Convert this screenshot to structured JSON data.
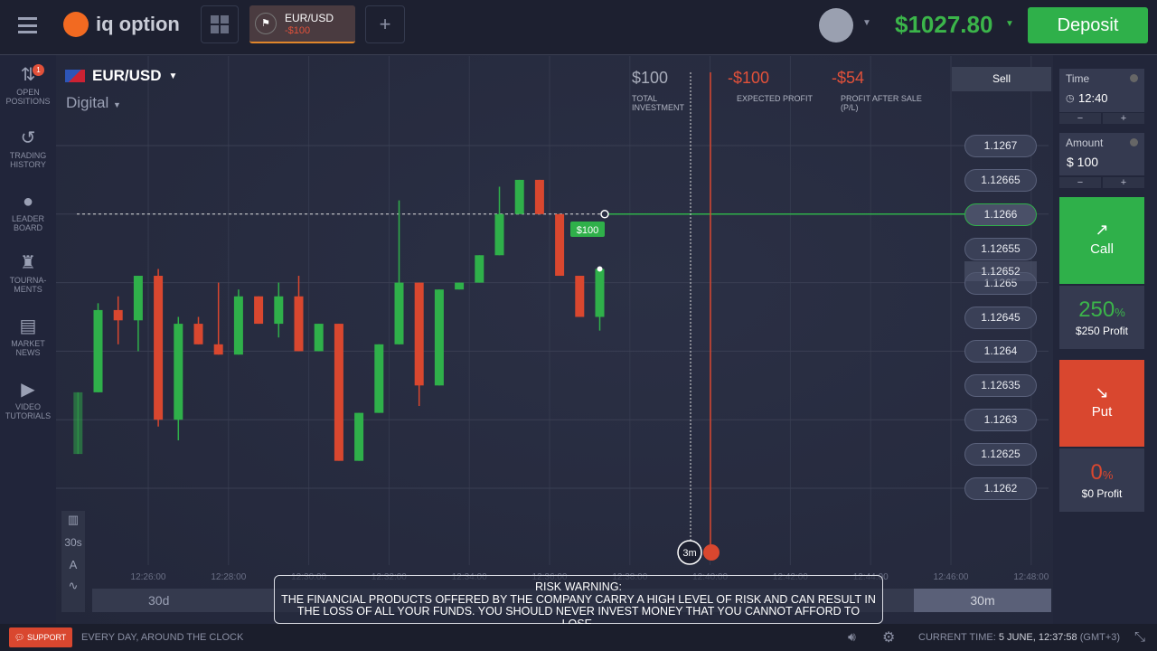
{
  "header": {
    "logo_text": "iq option",
    "tab": {
      "symbol": "EUR/USD",
      "pnl": "-$100"
    },
    "add_tab": "+",
    "balance": "$1027.80",
    "deposit": "Deposit"
  },
  "sidebar": {
    "badge": "1",
    "items": [
      {
        "label": "OPEN POSITIONS",
        "icon": "arrows-updown-icon"
      },
      {
        "label": "TRADING HISTORY",
        "icon": "history-icon"
      },
      {
        "label": "LEADER BOARD",
        "icon": "medal-icon"
      },
      {
        "label": "TOURNA-MENTS",
        "icon": "trophy-icon"
      },
      {
        "label": "MARKET NEWS",
        "icon": "news-icon"
      },
      {
        "label": "VIDEO TUTORIALS",
        "icon": "play-icon"
      }
    ]
  },
  "asset": {
    "name": "EUR/USD",
    "type": "Digital"
  },
  "stats": {
    "investment": "$100",
    "investment_label": "TOTAL INVESTMENT",
    "expected": "-$100",
    "expected_label": "EXPECTED PROFIT",
    "after_sale": "-$54",
    "after_sale_label": "PROFIT AFTER SALE (P/L)",
    "sell": "Sell"
  },
  "trade": {
    "time_label": "Time",
    "time": "12:40",
    "amount_label": "Amount",
    "amount": "$ 100",
    "minus": "−",
    "plus": "+",
    "call": "Call",
    "call_pct": "250",
    "call_profit": "$250 Profit",
    "put": "Put",
    "put_pct": "0",
    "put_profit": "$0 Profit",
    "pct_sign": "%"
  },
  "colors": {
    "green": "#2fb04a",
    "red": "#d9472f",
    "orange": "#f26a21"
  },
  "chart_data": {
    "type": "candlestick",
    "symbol": "EUR/USD",
    "interval": "30s",
    "range": "30m",
    "price_labels": [
      "1.1267",
      "1.12665",
      "1.1266",
      "1.12655",
      "1.1265",
      "1.12645",
      "1.1264",
      "1.12635",
      "1.1263",
      "1.12625",
      "1.1262"
    ],
    "current_price": "1.12652",
    "time_ticks": [
      "12:26:00",
      "12:28:00",
      "12:30:00",
      "12:32:00",
      "12:34:00",
      "12:36:00",
      "12:38:00",
      "12:40:00",
      "12:42:00",
      "12:44:00",
      "12:46:00",
      "12:48:00"
    ],
    "ylim": [
      1.1262,
      1.1267
    ],
    "strike_price": 1.1266,
    "position_tag": "$100",
    "expiry_marker": "3m",
    "candles": [
      {
        "t": "12:24:15",
        "o": 1.12625,
        "h": 1.12634,
        "l": 1.12625,
        "c": 1.12634
      },
      {
        "t": "12:24:45",
        "o": 1.12634,
        "h": 1.12647,
        "l": 1.12634,
        "c": 1.12646
      },
      {
        "t": "12:25:15",
        "o": 1.12646,
        "h": 1.12648,
        "l": 1.12641,
        "c": 1.126445
      },
      {
        "t": "12:25:45",
        "o": 1.126445,
        "h": 1.12651,
        "l": 1.1264,
        "c": 1.12651
      },
      {
        "t": "12:26:15",
        "o": 1.12651,
        "h": 1.12652,
        "l": 1.12629,
        "c": 1.1263
      },
      {
        "t": "12:26:45",
        "o": 1.1263,
        "h": 1.12645,
        "l": 1.12627,
        "c": 1.12644
      },
      {
        "t": "12:27:15",
        "o": 1.12644,
        "h": 1.12645,
        "l": 1.12641,
        "c": 1.12641
      },
      {
        "t": "12:27:45",
        "o": 1.12641,
        "h": 1.1265,
        "l": 1.126395,
        "c": 1.126395
      },
      {
        "t": "12:28:15",
        "o": 1.126395,
        "h": 1.12649,
        "l": 1.126395,
        "c": 1.12648
      },
      {
        "t": "12:28:45",
        "o": 1.12648,
        "h": 1.12648,
        "l": 1.12644,
        "c": 1.12644
      },
      {
        "t": "12:29:15",
        "o": 1.12644,
        "h": 1.1265,
        "l": 1.12642,
        "c": 1.12648
      },
      {
        "t": "12:29:45",
        "o": 1.12648,
        "h": 1.12651,
        "l": 1.1264,
        "c": 1.1264
      },
      {
        "t": "12:30:15",
        "o": 1.1264,
        "h": 1.12644,
        "l": 1.1264,
        "c": 1.12644
      },
      {
        "t": "12:30:45",
        "o": 1.12644,
        "h": 1.12644,
        "l": 1.12624,
        "c": 1.12624
      },
      {
        "t": "12:31:15",
        "o": 1.12624,
        "h": 1.12631,
        "l": 1.12624,
        "c": 1.12631
      },
      {
        "t": "12:31:45",
        "o": 1.12631,
        "h": 1.12641,
        "l": 1.12631,
        "c": 1.12641
      },
      {
        "t": "12:32:15",
        "o": 1.12641,
        "h": 1.12662,
        "l": 1.12641,
        "c": 1.1265
      },
      {
        "t": "12:32:45",
        "o": 1.1265,
        "h": 1.1265,
        "l": 1.12632,
        "c": 1.12635
      },
      {
        "t": "12:33:15",
        "o": 1.12635,
        "h": 1.12649,
        "l": 1.12635,
        "c": 1.12649
      },
      {
        "t": "12:33:45",
        "o": 1.12649,
        "h": 1.1265,
        "l": 1.12649,
        "c": 1.1265
      },
      {
        "t": "12:34:15",
        "o": 1.1265,
        "h": 1.12654,
        "l": 1.1265,
        "c": 1.12654
      },
      {
        "t": "12:34:45",
        "o": 1.12654,
        "h": 1.12664,
        "l": 1.12654,
        "c": 1.1266
      },
      {
        "t": "12:35:15",
        "o": 1.1266,
        "h": 1.12665,
        "l": 1.1266,
        "c": 1.12665
      },
      {
        "t": "12:35:45",
        "o": 1.12665,
        "h": 1.12665,
        "l": 1.1266,
        "c": 1.1266
      },
      {
        "t": "12:36:15",
        "o": 1.1266,
        "h": 1.1266,
        "l": 1.12651,
        "c": 1.12651
      },
      {
        "t": "12:36:45",
        "o": 1.12651,
        "h": 1.12651,
        "l": 1.12645,
        "c": 1.12645
      },
      {
        "t": "12:37:15",
        "o": 1.12645,
        "h": 1.12652,
        "l": 1.12643,
        "c": 1.12652
      }
    ]
  },
  "toolbar": {
    "interval": "30s"
  },
  "timeline": {
    "left": "30d",
    "right": "30m"
  },
  "risk": {
    "title": "RISK WARNING:",
    "text": "THE FINANCIAL PRODUCTS OFFERED BY THE COMPANY CARRY A HIGH LEVEL OF RISK AND CAN RESULT IN THE LOSS OF ALL YOUR FUNDS. YOU SHOULD NEVER INVEST MONEY THAT YOU CANNOT AFFORD TO LOSE."
  },
  "footer": {
    "support": "SUPPORT",
    "support_text": "EVERY DAY, AROUND THE CLOCK",
    "time_label": "CURRENT TIME:",
    "time_value": "5 JUNE, 12:37:58",
    "tz": "(GMT+3)"
  }
}
